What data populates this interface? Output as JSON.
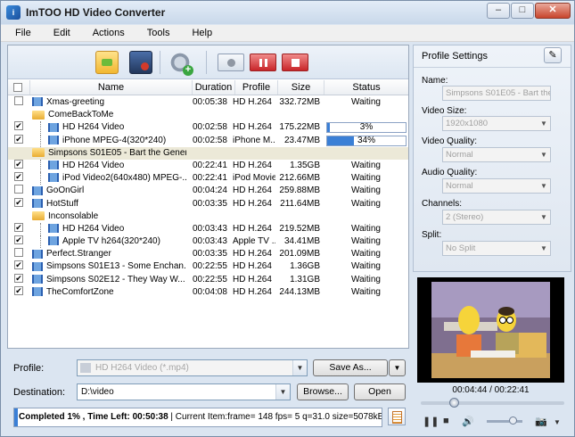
{
  "window": {
    "title": "ImTOO HD Video Converter",
    "app_icon": "imtoo-logo-icon"
  },
  "window_buttons": {
    "minimize": "–",
    "maximize": "□",
    "close": "✕"
  },
  "menu": [
    "File",
    "Edit",
    "Actions",
    "Tools",
    "Help"
  ],
  "table": {
    "headers": {
      "name": "Name",
      "duration": "Duration",
      "profile": "Profile",
      "size": "Size",
      "status": "Status"
    },
    "rows": [
      {
        "name": "Xmas-greeting",
        "duration": "00:05:38",
        "profile": "HD H.264",
        "size": "332.72MB",
        "status": "Waiting",
        "checked": false,
        "type": "file",
        "level": 0
      },
      {
        "name": "ComeBackToMe",
        "duration": "",
        "profile": "",
        "size": "",
        "status": "",
        "checked": false,
        "type": "folder",
        "level": 0
      },
      {
        "name": "HD H264 Video",
        "duration": "00:02:58",
        "profile": "HD H.264",
        "size": "175.22MB",
        "status": "3%",
        "progress": 0.03,
        "checked": true,
        "type": "file",
        "level": 1
      },
      {
        "name": "iPhone MPEG-4(320*240)",
        "duration": "00:02:58",
        "profile": "iPhone M...",
        "size": "23.47MB",
        "status": "34%",
        "progress": 0.34,
        "checked": true,
        "type": "file",
        "level": 1
      },
      {
        "name": "Simpsons S01E05 - Bart the General",
        "duration": "",
        "profile": "",
        "size": "",
        "status": "",
        "checked": false,
        "type": "folder",
        "level": 0,
        "selected": true
      },
      {
        "name": "HD H264 Video",
        "duration": "00:22:41",
        "profile": "HD H.264",
        "size": "1.35GB",
        "status": "Waiting",
        "checked": true,
        "type": "file",
        "level": 1
      },
      {
        "name": "iPod Video2(640x480) MPEG-...",
        "duration": "00:22:41",
        "profile": "iPod Movie",
        "size": "212.66MB",
        "status": "Waiting",
        "checked": true,
        "type": "file",
        "level": 1
      },
      {
        "name": "GoOnGirl",
        "duration": "00:04:24",
        "profile": "HD H.264",
        "size": "259.88MB",
        "status": "Waiting",
        "checked": false,
        "type": "file",
        "level": 0
      },
      {
        "name": "HotStuff",
        "duration": "00:03:35",
        "profile": "HD H.264",
        "size": "211.64MB",
        "status": "Waiting",
        "checked": true,
        "type": "file",
        "level": 0
      },
      {
        "name": "Inconsolable",
        "duration": "",
        "profile": "",
        "size": "",
        "status": "",
        "checked": false,
        "type": "folder",
        "level": 0
      },
      {
        "name": "HD H264 Video",
        "duration": "00:03:43",
        "profile": "HD H.264",
        "size": "219.52MB",
        "status": "Waiting",
        "checked": true,
        "type": "file",
        "level": 1
      },
      {
        "name": "Apple TV h264(320*240)",
        "duration": "00:03:43",
        "profile": "Apple TV ...",
        "size": "34.41MB",
        "status": "Waiting",
        "checked": true,
        "type": "file",
        "level": 1
      },
      {
        "name": "Perfect.Stranger",
        "duration": "00:03:35",
        "profile": "HD H.264",
        "size": "201.09MB",
        "status": "Waiting",
        "checked": false,
        "type": "file",
        "level": 0
      },
      {
        "name": "Simpsons S01E13 - Some Enchan...",
        "duration": "00:22:55",
        "profile": "HD H.264",
        "size": "1.36GB",
        "status": "Waiting",
        "checked": true,
        "type": "file",
        "level": 0
      },
      {
        "name": "Simpsons S02E12 - They Way W...",
        "duration": "00:22:55",
        "profile": "HD H.264",
        "size": "1.31GB",
        "status": "Waiting",
        "checked": true,
        "type": "file",
        "level": 0
      },
      {
        "name": "TheComfortZone",
        "duration": "00:04:08",
        "profile": "HD H.264",
        "size": "244.13MB",
        "status": "Waiting",
        "checked": true,
        "type": "file",
        "level": 0
      }
    ]
  },
  "profile_settings": {
    "title": "Profile Settings",
    "name_label": "Name:",
    "name_value": "Simpsons S01E05 - Bart the G",
    "video_size_label": "Video Size:",
    "video_size_value": "1920x1080",
    "video_quality_label": "Video Quality:",
    "video_quality_value": "Normal",
    "audio_quality_label": "Audio Quality:",
    "audio_quality_value": "Normal",
    "channels_label": "Channels:",
    "channels_value": "2 (Stereo)",
    "split_label": "Split:",
    "split_value": "No Split"
  },
  "preview": {
    "time": "00:04:44 / 00:22:41",
    "seek_fraction": 0.21,
    "volume_fraction": 0.7
  },
  "bottom": {
    "profile_label": "Profile:",
    "profile_value": "HD H264 Video (*.mp4)",
    "save_as": "Save As...",
    "destination_label": "Destination:",
    "destination_value": "D:\\video",
    "browse": "Browse...",
    "open": "Open"
  },
  "status": {
    "completed": "Completed 1% , Time Left: 00:50:38",
    "detail": " | Current Item:frame=  148 fps=  5 q=31.0 size=5078kB"
  }
}
